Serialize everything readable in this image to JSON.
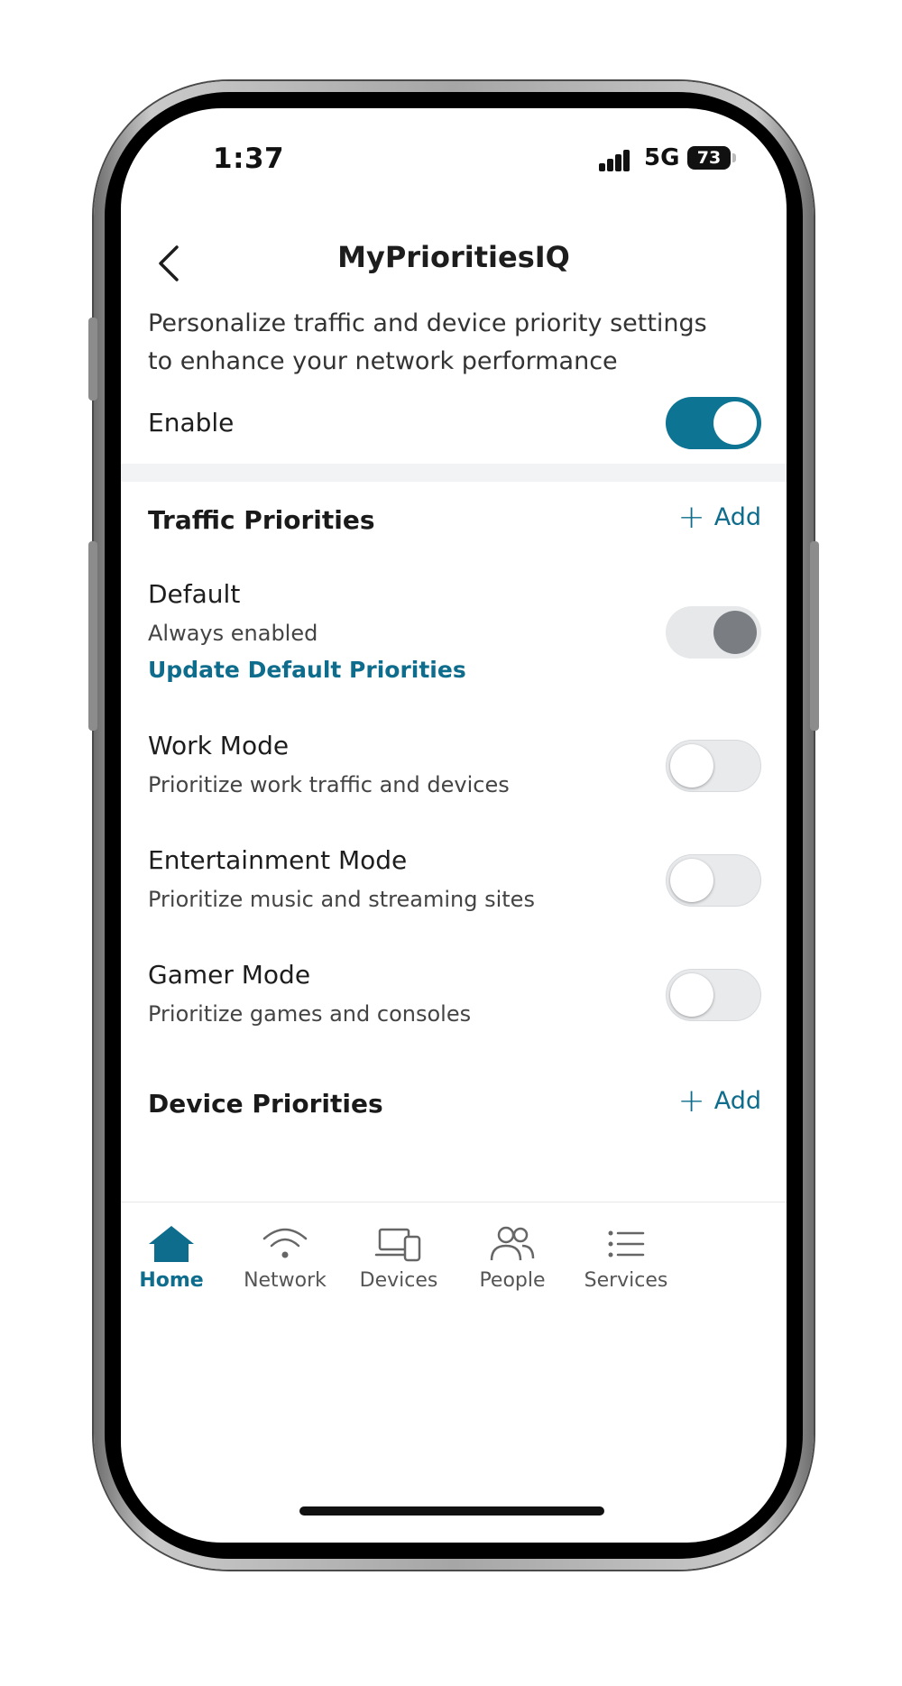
{
  "status_bar": {
    "time": "1:37",
    "network": "5G",
    "battery": "73"
  },
  "header": {
    "title": "MyPrioritiesIQ"
  },
  "description": "Personalize traffic and device priority settings to enhance your network performance",
  "enable": {
    "label": "Enable",
    "state": "on"
  },
  "traffic_priorities": {
    "title": "Traffic Priorities",
    "add_label": "Add",
    "items": [
      {
        "title": "Default",
        "subtitle": "Always enabled",
        "link": "Update Default Priorities",
        "state": "disabled-on"
      },
      {
        "title": "Work Mode",
        "subtitle": "Prioritize work traffic and devices",
        "state": "off"
      },
      {
        "title": "Entertainment Mode",
        "subtitle": "Prioritize music and streaming sites",
        "state": "off"
      },
      {
        "title": "Gamer Mode",
        "subtitle": "Prioritize games and consoles",
        "state": "off"
      }
    ]
  },
  "device_priorities": {
    "title": "Device Priorities",
    "add_label": "Add"
  },
  "bottom_nav": {
    "items": [
      {
        "label": "Home",
        "icon": "home-icon",
        "active": true
      },
      {
        "label": "Network",
        "icon": "wifi-icon",
        "active": false
      },
      {
        "label": "Devices",
        "icon": "devices-icon",
        "active": false
      },
      {
        "label": "People",
        "icon": "people-icon",
        "active": false
      },
      {
        "label": "Services",
        "icon": "list-icon",
        "active": false
      }
    ]
  },
  "colors": {
    "accent": "#0e7493",
    "link": "#0e6c8c",
    "toggle_off": "#e8eaec",
    "toggle_disabled_knob": "#7a7e82"
  }
}
